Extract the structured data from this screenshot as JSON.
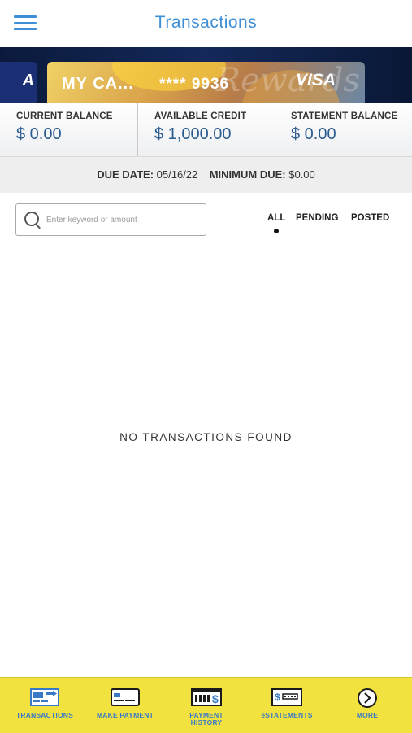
{
  "header": {
    "title": "Transactions",
    "menu_icon": "hamburger-menu-icon"
  },
  "card": {
    "prev_brand": "A",
    "name": "MY CA...",
    "number": "**** 9936",
    "network": "VISA",
    "watermark": "Rewards"
  },
  "balances": [
    {
      "label": "CURRENT BALANCE",
      "value": "$ 0.00"
    },
    {
      "label": "AVAILABLE CREDIT",
      "value": "$ 1,000.00"
    },
    {
      "label": "STATEMENT BALANCE",
      "value": "$ 0.00"
    }
  ],
  "due": {
    "due_date_label": "DUE DATE:",
    "due_date_value": "05/16/22",
    "minimum_due_label": "MINIMUM DUE:",
    "minimum_due_value": "$0.00"
  },
  "search": {
    "placeholder": "Enter keyword or amount",
    "value": ""
  },
  "filters": {
    "all": "ALL",
    "pending": "PENDING",
    "posted": "POSTED",
    "selected": "ALL"
  },
  "empty_message": "NO TRANSACTIONS FOUND",
  "tabs": [
    {
      "label": "TRANSACTIONS",
      "icon": "transactions-icon"
    },
    {
      "label": "MAKE PAYMENT",
      "icon": "card-payment-icon"
    },
    {
      "label": "PAYMENT HISTORY",
      "line1": "PAYMENT",
      "line2": "HISTORY",
      "icon": "payment-history-icon"
    },
    {
      "label": "eSTATEMENTS",
      "icon": "estatements-icon"
    },
    {
      "label": "MORE",
      "icon": "chevron-right-circle-icon"
    }
  ],
  "colors": {
    "accent": "#3f8fd6",
    "tabbar": "#f2e23f",
    "tab_text": "#3a79c7",
    "balance_value": "#2a5b8f"
  }
}
